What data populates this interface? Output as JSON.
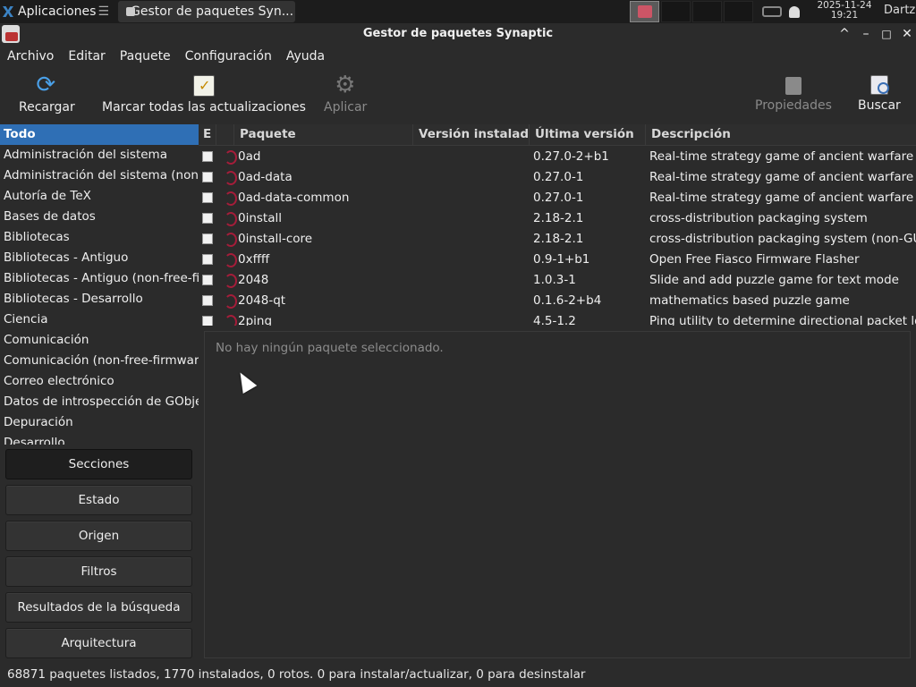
{
  "panel": {
    "apps_label": "Aplicaciones",
    "task_label": "Gestor de paquetes Syn...",
    "clock_date": "2025-11-24",
    "clock_time": "19:21",
    "user": "Dartz"
  },
  "window": {
    "title": "Gestor de paquetes Synaptic",
    "controls": [
      "^",
      "–",
      "□",
      "✕"
    ]
  },
  "menu": [
    "Archivo",
    "Editar",
    "Paquete",
    "Configuración",
    "Ayuda"
  ],
  "toolbar": {
    "reload": "Recargar",
    "mark_all": "Marcar todas las actualizaciones",
    "apply": "Aplicar",
    "properties": "Propiedades",
    "search": "Buscar"
  },
  "sections": [
    "Todo",
    "Administración del sistema",
    "Administración del sistema (non-",
    "Autoría de TeX",
    "Bases de datos",
    "Bibliotecas",
    "Bibliotecas - Antiguo",
    "Bibliotecas - Antiguo (non-free-fir",
    "Bibliotecas - Desarrollo",
    "Ciencia",
    "Comunicación",
    "Comunicación (non-free-firmware",
    "Correo electrónico",
    "Datos de introspección de GObjec",
    "Depuración",
    "Desarrollo"
  ],
  "filter_buttons": [
    "Secciones",
    "Estado",
    "Origen",
    "Filtros",
    "Resultados de la búsqueda",
    "Arquitectura"
  ],
  "table": {
    "headers": [
      "E",
      "",
      "Paquete",
      "Versión instalada",
      "Última versión",
      "Descripción"
    ],
    "rows": [
      {
        "name": "0ad",
        "installed": "",
        "latest": "0.27.0-2+b1",
        "desc": "Real-time strategy game of ancient warfare"
      },
      {
        "name": "0ad-data",
        "installed": "",
        "latest": "0.27.0-1",
        "desc": "Real-time strategy game of ancient warfare (d"
      },
      {
        "name": "0ad-data-common",
        "installed": "",
        "latest": "0.27.0-1",
        "desc": "Real-time strategy game of ancient warfare (c"
      },
      {
        "name": "0install",
        "installed": "",
        "latest": "2.18-2.1",
        "desc": "cross-distribution packaging system"
      },
      {
        "name": "0install-core",
        "installed": "",
        "latest": "2.18-2.1",
        "desc": "cross-distribution packaging system (non-GUI"
      },
      {
        "name": "0xffff",
        "installed": "",
        "latest": "0.9-1+b1",
        "desc": "Open Free Fiasco Firmware Flasher"
      },
      {
        "name": "2048",
        "installed": "",
        "latest": "1.0.3-1",
        "desc": "Slide and add puzzle game for text mode"
      },
      {
        "name": "2048-qt",
        "installed": "",
        "latest": "0.1.6-2+b4",
        "desc": "mathematics based puzzle game"
      },
      {
        "name": "2ping",
        "installed": "",
        "latest": "4.5-1.2",
        "desc": "Ping utility to determine directional packet los"
      }
    ]
  },
  "details": {
    "empty_text": "No hay ningún paquete seleccionado."
  },
  "status": "68871 paquetes listados, 1770 instalados, 0 rotos. 0 para instalar/actualizar, 0 para desinstalar"
}
